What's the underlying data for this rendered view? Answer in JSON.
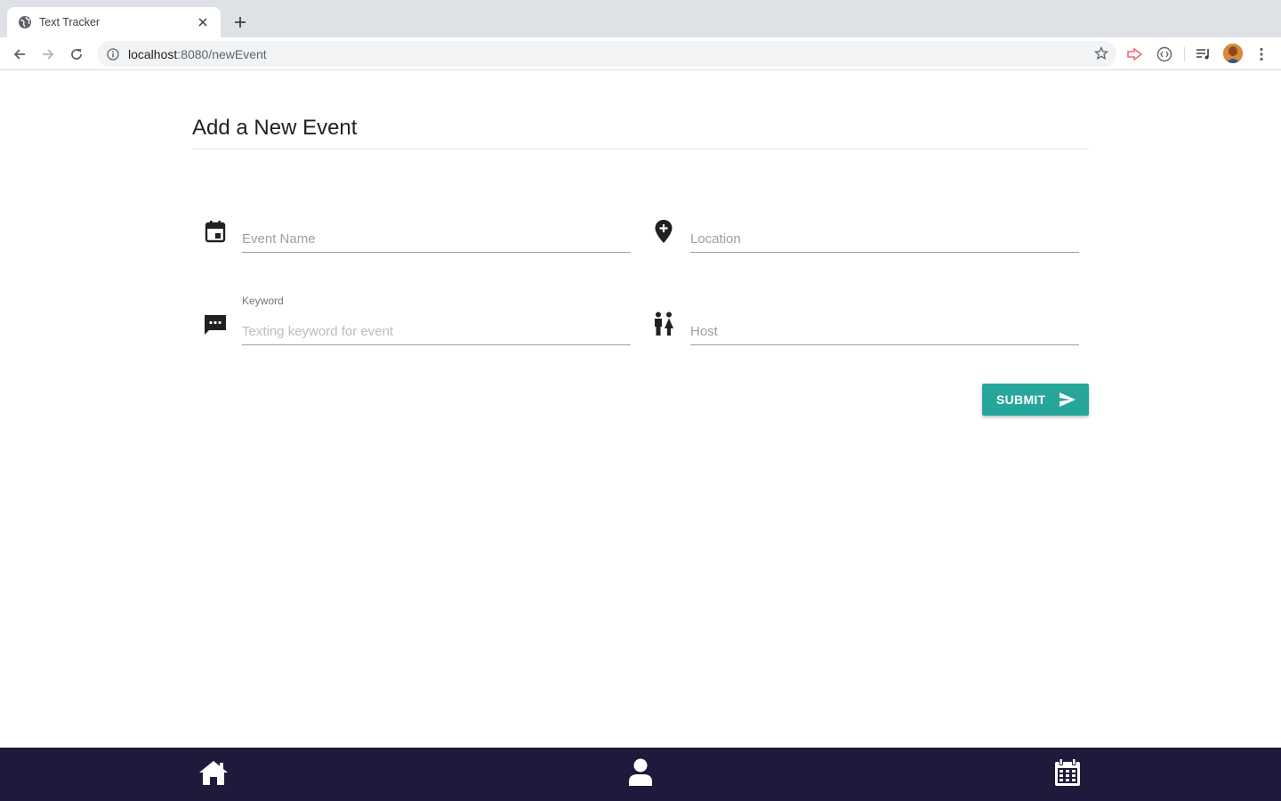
{
  "browser": {
    "tab_title": "Text Tracker",
    "url_host": "localhost",
    "url_path": ":8080/newEvent"
  },
  "page": {
    "title": "Add a New Event"
  },
  "form": {
    "event_name": {
      "placeholder": "Event Name",
      "icon": "event-icon"
    },
    "location": {
      "placeholder": "Location",
      "icon": "add-location-icon"
    },
    "keyword": {
      "label": "Keyword",
      "placeholder": "Texting keyword for event",
      "icon": "sms-icon"
    },
    "host": {
      "placeholder": "Host",
      "icon": "people-icon"
    },
    "submit_label": "SUBMIT"
  },
  "bottom_nav": {
    "items": [
      {
        "icon": "home-icon"
      },
      {
        "icon": "user-icon"
      },
      {
        "icon": "calendar-icon"
      }
    ]
  },
  "colors": {
    "accent": "#26a69a",
    "nav_background": "#1e1a3c"
  }
}
